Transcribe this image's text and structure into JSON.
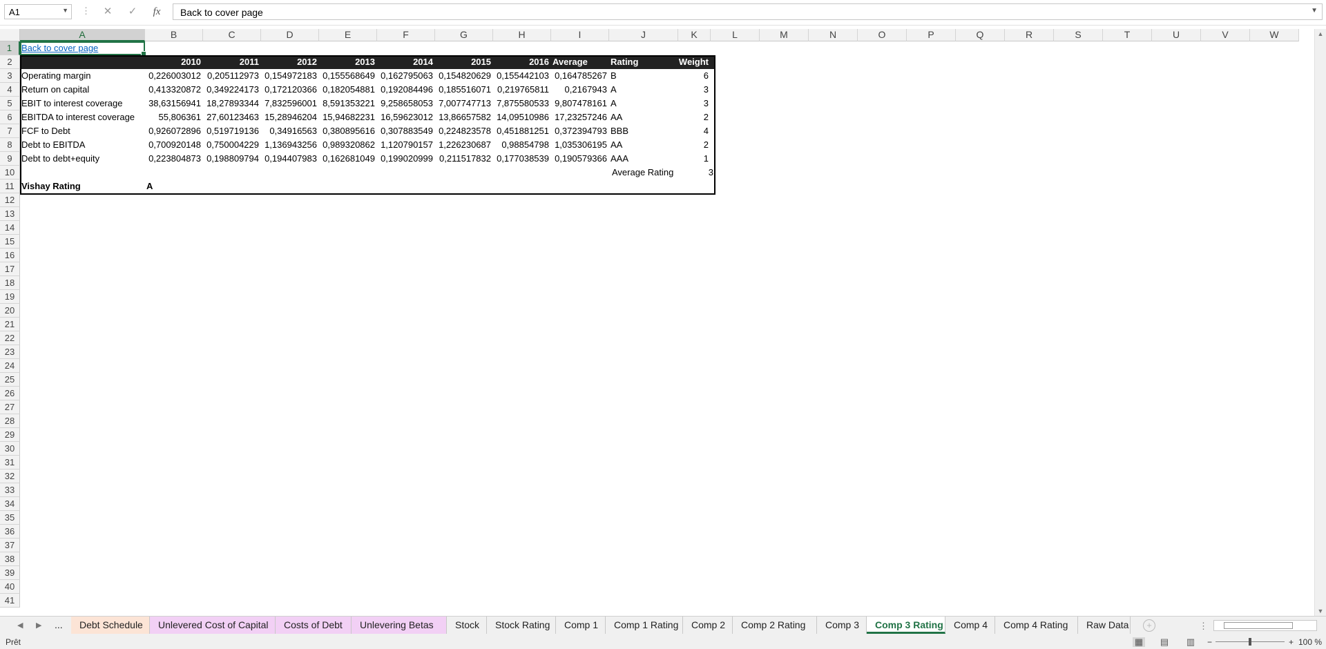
{
  "formula_bar": {
    "name_box": "A1",
    "cancel_icon": "✕",
    "enter_icon": "✓",
    "fx_icon": "fx",
    "content": "Back to cover page"
  },
  "columns": [
    "A",
    "B",
    "C",
    "D",
    "E",
    "F",
    "G",
    "H",
    "I",
    "J",
    "K",
    "L",
    "M",
    "N",
    "O",
    "P",
    "Q",
    "R",
    "S",
    "T",
    "U",
    "V",
    "W"
  ],
  "rows": [
    "1",
    "2",
    "3",
    "4",
    "5",
    "6",
    "7",
    "8",
    "9",
    "10",
    "11",
    "12",
    "13",
    "14",
    "15",
    "16",
    "17",
    "18",
    "19",
    "20",
    "21",
    "22",
    "23",
    "24",
    "25",
    "26",
    "27",
    "28",
    "29",
    "30",
    "31",
    "32",
    "33",
    "34",
    "35",
    "36",
    "37",
    "38",
    "39",
    "40",
    "41"
  ],
  "sheet": {
    "link": "Back to cover page",
    "header": {
      "years": [
        "2010",
        "2011",
        "2012",
        "2013",
        "2014",
        "2015",
        "2016"
      ],
      "average": "Average",
      "rating": "Rating",
      "weight": "Weight"
    },
    "metrics": [
      {
        "name": "Operating margin",
        "values": [
          "0,226003012",
          "0,205112973",
          "0,154972183",
          "0,155568649",
          "0,162795063",
          "0,154820629",
          "0,155442103"
        ],
        "average": "0,164785267",
        "rating": "B",
        "weight": "6"
      },
      {
        "name": "Return on capital",
        "values": [
          "0,413320872",
          "0,349224173",
          "0,172120366",
          "0,182054881",
          "0,192084496",
          "0,185516071",
          "0,219765811"
        ],
        "average": "0,2167943",
        "rating": "A",
        "weight": "3"
      },
      {
        "name": "EBIT to interest coverage",
        "values": [
          "38,63156941",
          "18,27893344",
          "7,832596001",
          "8,591353221",
          "9,258658053",
          "7,007747713",
          "7,875580533"
        ],
        "average": "9,807478161",
        "rating": "A",
        "weight": "3"
      },
      {
        "name": "EBITDA to interest coverage",
        "values": [
          "55,806361",
          "27,60123463",
          "15,28946204",
          "15,94682231",
          "16,59623012",
          "13,86657582",
          "14,09510986"
        ],
        "average": "17,23257246",
        "rating": "AA",
        "weight": "2"
      },
      {
        "name": "FCF to Debt",
        "values": [
          "0,926072896",
          "0,519719136",
          "0,34916563",
          "0,380895616",
          "0,307883549",
          "0,224823578",
          "0,451881251"
        ],
        "average": "0,372394793",
        "rating": "BBB",
        "weight": "4"
      },
      {
        "name": "Debt to EBITDA",
        "values": [
          "0,700920148",
          "0,750004229",
          "1,136943256",
          "0,989320862",
          "1,120790157",
          "1,226230687",
          "0,98854798"
        ],
        "average": "1,035306195",
        "rating": "AA",
        "weight": "2"
      },
      {
        "name": "Debt to debt+equity",
        "values": [
          "0,223804873",
          "0,198809794",
          "0,194407983",
          "0,162681049",
          "0,199020999",
          "0,211517832",
          "0,177038539"
        ],
        "average": "0,190579366",
        "rating": "AAA",
        "weight": "1"
      }
    ],
    "average_rating_label": "Average Rating",
    "average_rating_value": "3",
    "final_label": "Vishay Rating",
    "final_value": "A"
  },
  "tabs": [
    {
      "label": "...",
      "color": ""
    },
    {
      "label": "Debt Schedule",
      "color": "#fce4d6"
    },
    {
      "label": "Unlevered Cost of Capital",
      "color": "#f2d0f5"
    },
    {
      "label": "Costs of Debt",
      "color": "#f2d0f5"
    },
    {
      "label": "Unlevering Betas",
      "color": "#f2d0f5"
    },
    {
      "label": "Stock",
      "color": ""
    },
    {
      "label": "Stock Rating",
      "color": ""
    },
    {
      "label": "Comp 1",
      "color": ""
    },
    {
      "label": "Comp 1 Rating",
      "color": ""
    },
    {
      "label": "Comp 2",
      "color": ""
    },
    {
      "label": "Comp 2 Rating",
      "color": ""
    },
    {
      "label": "Comp 3",
      "color": ""
    },
    {
      "label": "Comp 3 Rating",
      "color": "",
      "active": true
    },
    {
      "label": "Comp 4",
      "color": ""
    },
    {
      "label": "Comp 4 Rating",
      "color": ""
    },
    {
      "label": "Raw Data",
      "color": ""
    }
  ],
  "status": {
    "text": "Prêt",
    "zoom_minus": "−",
    "zoom_plus": "+",
    "zoom_level": "100 %"
  },
  "colors": {
    "accent": "#217346",
    "header_band": "#222222",
    "link": "#0563c1"
  }
}
